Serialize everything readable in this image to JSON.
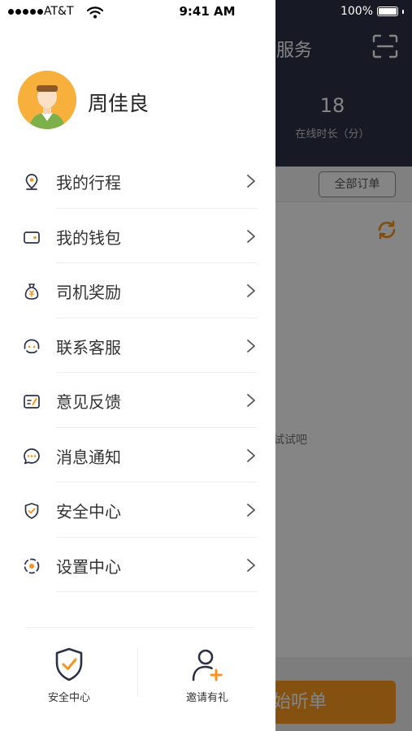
{
  "status_bar": {
    "carrier": "AT&T",
    "time": "9:41 AM",
    "battery": "100%"
  },
  "background": {
    "title": "服务",
    "online_minutes": "18",
    "online_label": "在线时长（分）",
    "all_orders": "全部订单",
    "hint": "试试吧",
    "start_button": "始听单"
  },
  "drawer": {
    "user_name": "周佳良",
    "menu": [
      {
        "label": "我的行程",
        "icon": "location-pin-icon"
      },
      {
        "label": "我的钱包",
        "icon": "wallet-icon"
      },
      {
        "label": "司机奖励",
        "icon": "money-bag-icon"
      },
      {
        "label": "联系客服",
        "icon": "customer-service-icon"
      },
      {
        "label": "意见反馈",
        "icon": "feedback-icon"
      },
      {
        "label": "消息通知",
        "icon": "message-icon"
      },
      {
        "label": "安全中心",
        "icon": "shield-icon"
      },
      {
        "label": "设置中心",
        "icon": "settings-icon"
      }
    ],
    "footer": {
      "safety": "安全中心",
      "invite": "邀请有礼"
    }
  },
  "colors": {
    "accent": "#f7931e",
    "icon_navy": "#2c3046",
    "header_bg": "#2c3046",
    "start_button": "#ff9b1f"
  }
}
